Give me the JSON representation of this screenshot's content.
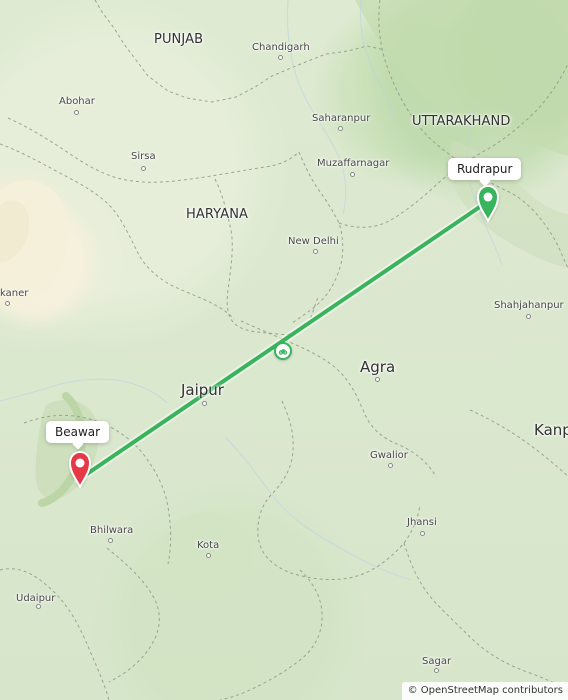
{
  "map": {
    "states": [
      {
        "name": "PUNJAB"
      },
      {
        "name": "HARYANA"
      },
      {
        "name": "UTTARAKHAND"
      }
    ],
    "cities": [
      {
        "name": "Chandigarh"
      },
      {
        "name": "Abohar"
      },
      {
        "name": "Sirsa"
      },
      {
        "name": "Saharanpur"
      },
      {
        "name": "Muzaffarnagar"
      },
      {
        "name": "New Delhi"
      },
      {
        "name": "Shahjahanpur"
      },
      {
        "name": "Agra"
      },
      {
        "name": "Jaipur"
      },
      {
        "name": "Kanp"
      },
      {
        "name": "Gwalior"
      },
      {
        "name": "Jhansi"
      },
      {
        "name": "Bhilwara"
      },
      {
        "name": "Kota"
      },
      {
        "name": "Udaipur"
      },
      {
        "name": "Sagar"
      },
      {
        "name": "kaner"
      }
    ],
    "route": {
      "start": {
        "label": "Beawar"
      },
      "end": {
        "label": "Rudrapur"
      },
      "color": "#39b45c"
    },
    "attribution": "© OpenStreetMap contributors"
  }
}
